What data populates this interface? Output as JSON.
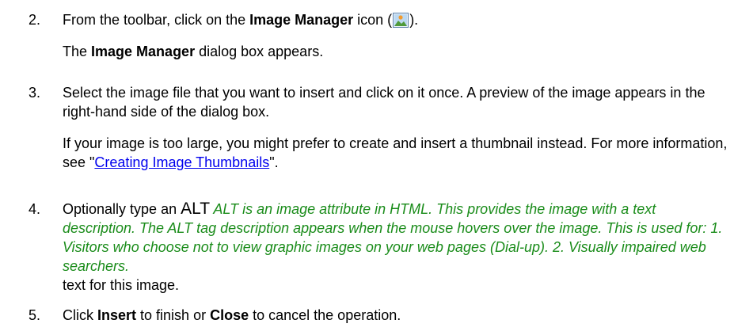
{
  "steps": [
    {
      "number": "2.",
      "pre": "From the toolbar, click on the ",
      "bold": "Image Manager",
      "post": " icon (",
      "icon": "image-manager-icon",
      "post2": ").",
      "line2_bold": "Image Manager",
      "line2_rest": " dialog box appears.",
      "line2_pre": "The "
    },
    {
      "number": "3.",
      "para1": "Select the image file that you want to insert and click on it once. A preview of the image appears in the right-hand side of the dialog box.",
      "para2_pre": "If your image is too large, you might prefer to create and insert a thumbnail instead. For more information, see \"",
      "para2_link": "Creating Image Thumbnails",
      "para2_post": "\"."
    },
    {
      "number": "4.",
      "pre": "Optionally type an ",
      "alt_word": "ALT",
      "popup": " ALT is an image attribute in HTML. This provides the image with a text description. The ALT tag description appears when the mouse hovers over the image. This is used for: 1. Visitors who choose not to view graphic images on your web pages (Dial-up). 2. Visually impaired web searchers.",
      "post": "text for this image."
    },
    {
      "number": "5.",
      "pre": "Click ",
      "bold1": "Insert",
      "mid": " to finish or ",
      "bold2": "Close",
      "post": " to cancel the operation."
    }
  ],
  "colors": {
    "link": "#0000ee",
    "popup_text": "#1a8c1a"
  }
}
